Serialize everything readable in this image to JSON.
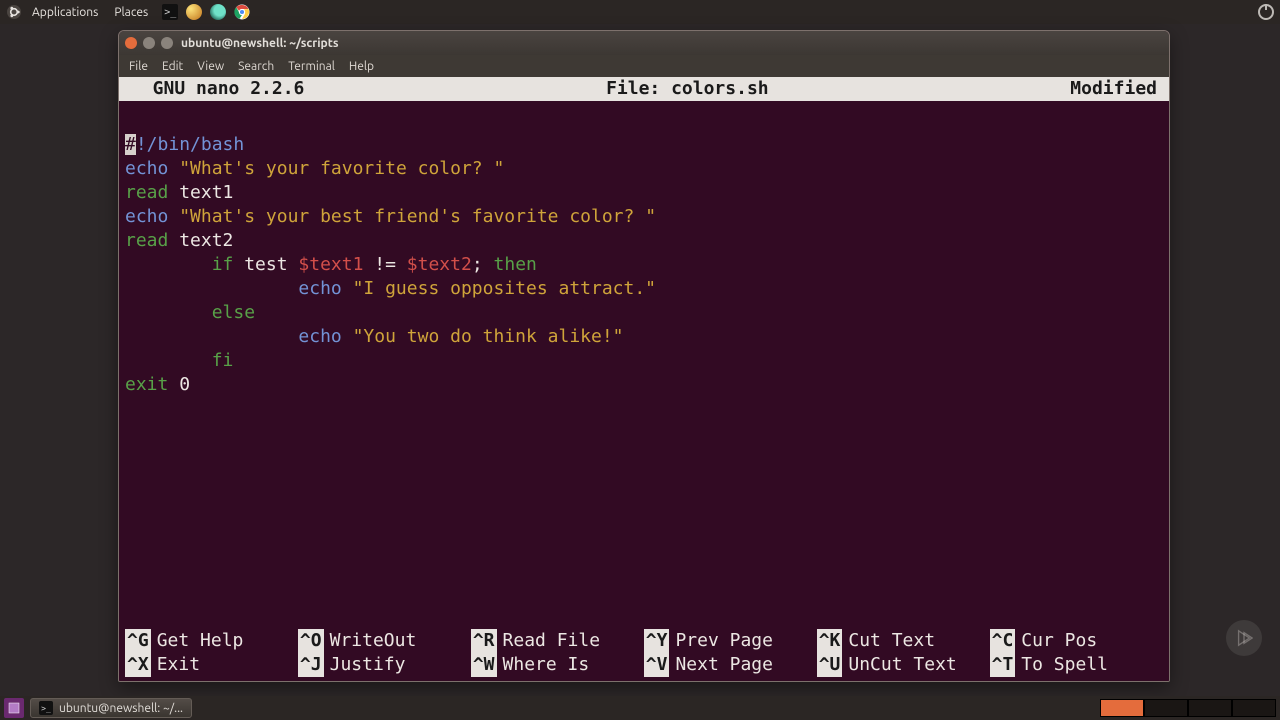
{
  "top_panel": {
    "applications": "Applications",
    "places": "Places"
  },
  "window": {
    "title": "ubuntu@newshell: ~/scripts",
    "menu": {
      "file": "File",
      "edit": "Edit",
      "view": "View",
      "search": "Search",
      "terminal": "Terminal",
      "help": "Help"
    }
  },
  "nano": {
    "app": "  GNU nano 2.2.6",
    "file_label": "File: colors.sh",
    "modified": "Modified"
  },
  "code": {
    "l1_hash": "#",
    "l1_rest": "!/bin/bash",
    "l2_cmd": "echo",
    "l2_str": "\"What's your favorite color? \"",
    "l3_cmd": "read",
    "l3_arg": " text1",
    "l4_cmd": "echo",
    "l4_str": "\"What's your best friend's favorite color? \"",
    "l5_cmd": "read",
    "l5_arg": " text2",
    "l6_indent": "        ",
    "l6_if": "if ",
    "l6_test": "test ",
    "l6_var1": "$text1",
    "l6_op": " != ",
    "l6_var2": "$text2",
    "l6_semi": "; ",
    "l6_then": "then",
    "l7_indent": "                ",
    "l7_cmd": "echo",
    "l7_str": " \"I guess opposites attract.\"",
    "l8_indent": "        ",
    "l8_else": "else",
    "l9_indent": "                ",
    "l9_cmd": "echo",
    "l9_str": " \"You two do think alike!\"",
    "l10_indent": "        ",
    "l10_fi": "fi",
    "l11_cmd": "exit",
    "l11_arg": " 0"
  },
  "shortcuts": {
    "row1": [
      {
        "key": "^G",
        "label": "Get Help"
      },
      {
        "key": "^O",
        "label": "WriteOut"
      },
      {
        "key": "^R",
        "label": "Read File"
      },
      {
        "key": "^Y",
        "label": "Prev Page"
      },
      {
        "key": "^K",
        "label": "Cut Text"
      },
      {
        "key": "^C",
        "label": "Cur Pos"
      }
    ],
    "row2": [
      {
        "key": "^X",
        "label": "Exit"
      },
      {
        "key": "^J",
        "label": "Justify"
      },
      {
        "key": "^W",
        "label": "Where Is"
      },
      {
        "key": "^V",
        "label": "Next Page"
      },
      {
        "key": "^U",
        "label": "UnCut Text"
      },
      {
        "key": "^T",
        "label": "To Spell"
      }
    ]
  },
  "taskbar": {
    "task1": "ubuntu@newshell: ~/..."
  }
}
